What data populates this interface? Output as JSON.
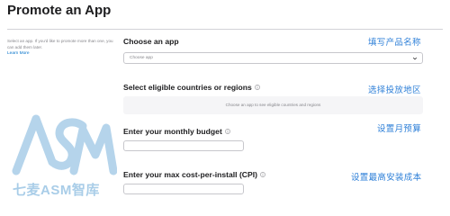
{
  "header": {
    "title": "Promote an App"
  },
  "sidebar": {
    "note": "Select an app. If you'd like to promote more than one, you can add them later.",
    "learn_more": "Learn More"
  },
  "sections": {
    "choose_app": {
      "label": "Choose an app",
      "placeholder": "Choose app"
    },
    "countries": {
      "label": "Select eligible countries or regions",
      "hint": "Choose an app to see eligible countries and regions"
    },
    "budget": {
      "label": "Enter your monthly budget",
      "value": ""
    },
    "cpi": {
      "label": "Enter your max cost-per-install (CPI)",
      "value": ""
    }
  },
  "annotations": {
    "choose_app": "填写产品名称",
    "countries": "选择投放地区",
    "budget": "设置月预算",
    "cpi": "设置最高安装成本"
  },
  "watermark": {
    "text": "七麦ASM智库"
  },
  "colors": {
    "annotation": "#2f80d8",
    "link": "#0070c9",
    "divider": "#d2d2d7",
    "watermark": "#a9cde8"
  },
  "icons": {
    "info": "info-circle-icon",
    "dropdown": "chevron-down-icon",
    "watermark_logo": "asm-logo-icon"
  }
}
